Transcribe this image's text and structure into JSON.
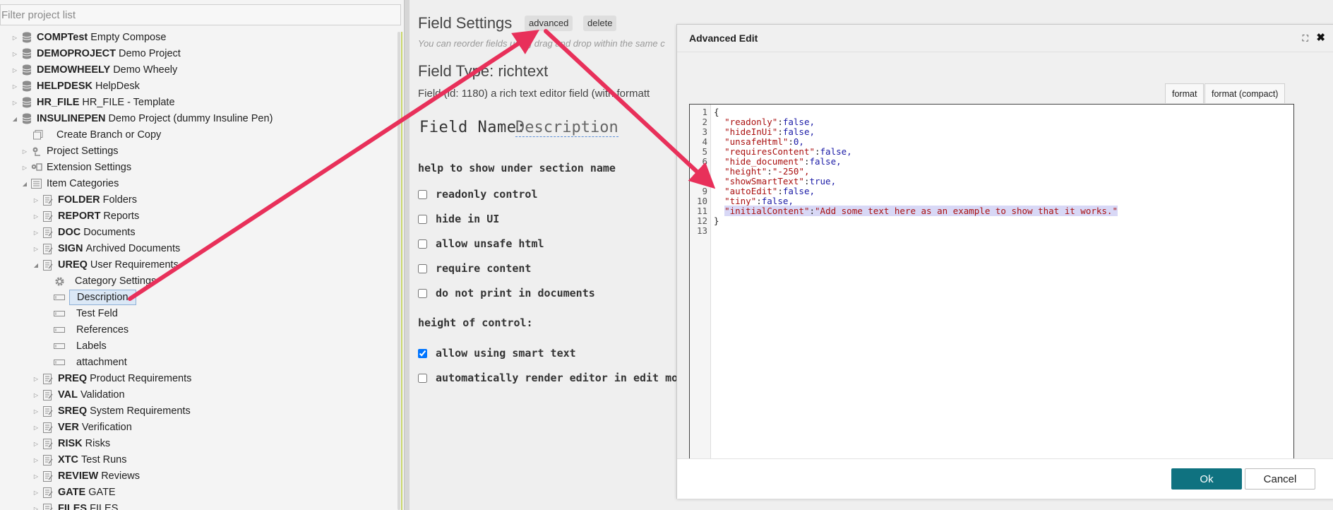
{
  "sidebar": {
    "filter_placeholder": "Filter project list",
    "items": [
      {
        "code": "COMPTest",
        "label": "Empty Compose"
      },
      {
        "code": "DEMOPROJECT",
        "label": "Demo Project"
      },
      {
        "code": "DEMOWHEELY",
        "label": "Demo Wheely"
      },
      {
        "code": "HELPDESK",
        "label": "HelpDesk"
      },
      {
        "code": "HR_FILE",
        "label": "HR_FILE - Template"
      },
      {
        "code": "INSULINEPEN",
        "label": "Demo Project (dummy Insuline Pen)"
      },
      {
        "code": "",
        "label": "Create Branch or Copy"
      },
      {
        "code": "",
        "label": "Project Settings"
      },
      {
        "code": "",
        "label": "Extension Settings"
      },
      {
        "code": "",
        "label": "Item Categories"
      },
      {
        "code": "FOLDER",
        "label": "Folders"
      },
      {
        "code": "REPORT",
        "label": "Reports"
      },
      {
        "code": "DOC",
        "label": "Documents"
      },
      {
        "code": "SIGN",
        "label": "Archived Documents"
      },
      {
        "code": "UREQ",
        "label": "User Requirements"
      },
      {
        "code": "",
        "label": "Category Settings"
      },
      {
        "code": "",
        "label": "Description"
      },
      {
        "code": "",
        "label": "Test Feld"
      },
      {
        "code": "",
        "label": "References"
      },
      {
        "code": "",
        "label": "Labels"
      },
      {
        "code": "",
        "label": "attachment"
      },
      {
        "code": "PREQ",
        "label": "Product Requirements"
      },
      {
        "code": "VAL",
        "label": "Validation"
      },
      {
        "code": "SREQ",
        "label": "System Requirements"
      },
      {
        "code": "VER",
        "label": "Verification"
      },
      {
        "code": "RISK",
        "label": "Risks"
      },
      {
        "code": "XTC",
        "label": "Test Runs"
      },
      {
        "code": "REVIEW",
        "label": "Reviews"
      },
      {
        "code": "GATE",
        "label": "GATE"
      },
      {
        "code": "FILES",
        "label": "FILES"
      }
    ]
  },
  "field_settings": {
    "title": "Field Settings",
    "advanced_label": "advanced",
    "delete_label": "delete",
    "reorder_hint": "You can reorder fields using drag and drop within the same c",
    "field_type": "Field Type: richtext",
    "field_id": "Field (id: 1180) a rich text editor field (with formatt",
    "field_name_label": "Field Name:",
    "field_name_value": "Description",
    "help_heading": "help to show under section name",
    "height_heading": "height of control:",
    "options": [
      {
        "label": "readonly control",
        "checked": false
      },
      {
        "label": "hide in UI",
        "checked": false
      },
      {
        "label": "allow unsafe html",
        "checked": false
      },
      {
        "label": "require content",
        "checked": false
      },
      {
        "label": "do not print in documents",
        "checked": false
      },
      {
        "label": "allow using smart text",
        "checked": true
      },
      {
        "label": "automatically render editor in edit mode",
        "checked": false
      }
    ]
  },
  "dialog": {
    "title": "Advanced Edit",
    "format_label": "format",
    "format_compact_label": "format (compact)",
    "ok_label": "Ok",
    "cancel_label": "Cancel",
    "lines": [
      {
        "n": "1",
        "key": "",
        "val": "{"
      },
      {
        "n": "2",
        "key": "\"readonly\"",
        "val": "false,"
      },
      {
        "n": "3",
        "key": "\"hideInUi\"",
        "val": "false,"
      },
      {
        "n": "4",
        "key": "\"unsafeHtml\"",
        "val": "0,"
      },
      {
        "n": "5",
        "key": "\"requiresContent\"",
        "val": "false,"
      },
      {
        "n": "6",
        "key": "\"hide_document\"",
        "val": "false,"
      },
      {
        "n": "7",
        "key": "\"height\"",
        "val": "\"-250\","
      },
      {
        "n": "8",
        "key": "\"showSmartText\"",
        "val": "true,"
      },
      {
        "n": "9",
        "key": "\"autoEdit\"",
        "val": "false,"
      },
      {
        "n": "10",
        "key": "\"tiny\"",
        "val": "false,"
      },
      {
        "n": "11",
        "key": "\"initialContent\"",
        "val": "\"Add some text here as an example to show that it works.\""
      },
      {
        "n": "12",
        "key": "",
        "val": "}"
      },
      {
        "n": "13",
        "key": "",
        "val": ""
      }
    ]
  },
  "colors": {
    "ok_button": "#0f7280",
    "arrow": "#e8305a",
    "selection": "#dbe8f6",
    "json_key": "#a11111",
    "json_value": "#1a1aa6"
  }
}
